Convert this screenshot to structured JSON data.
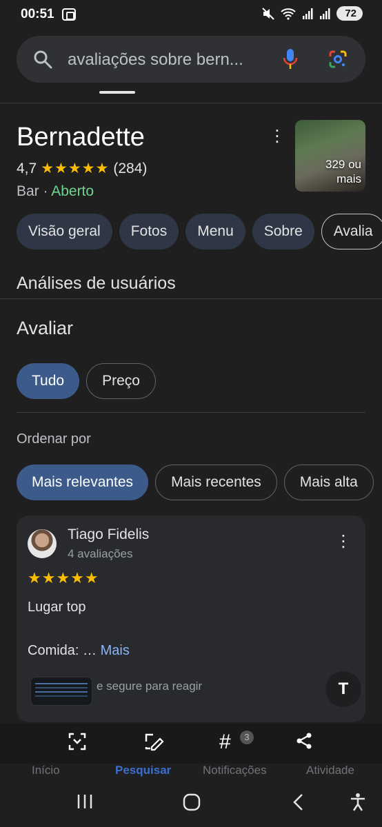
{
  "status": {
    "time": "00:51",
    "battery": "72"
  },
  "search": {
    "query": "avaliações sobre bern..."
  },
  "place": {
    "name": "Bernadette",
    "rating": "4,7",
    "stars": "★★★★★",
    "reviews": "(284)",
    "category": "Bar ·",
    "state": "Aberto",
    "photos_label_1": "329 ou",
    "photos_label_2": "mais"
  },
  "tabs": [
    "Visão geral",
    "Fotos",
    "Menu",
    "Sobre",
    "Avalia"
  ],
  "user_reviews_heading": "Análises de usuários",
  "rate": {
    "heading": "Avaliar",
    "filters": [
      "Tudo",
      "Preço"
    ]
  },
  "sort": {
    "label": "Ordenar por",
    "options": [
      "Mais relevantes",
      "Mais recentes",
      "Mais alta"
    ]
  },
  "review": {
    "author": "Tiago Fidelis",
    "count": "4 avaliações",
    "stars": "★★★★★",
    "line1": "Lugar top",
    "line2": "Comida: …",
    "more": "Mais",
    "react_hint": "e segure para reagir",
    "translate_icon": "T"
  },
  "bottom_nav": [
    "Início",
    "Pesquisar",
    "Notificações",
    "Atividade"
  ],
  "notif_badge": "3",
  "colors": {
    "accent": "#3c5a8a",
    "open": "#6dd58c",
    "star": "#fbbc04"
  }
}
